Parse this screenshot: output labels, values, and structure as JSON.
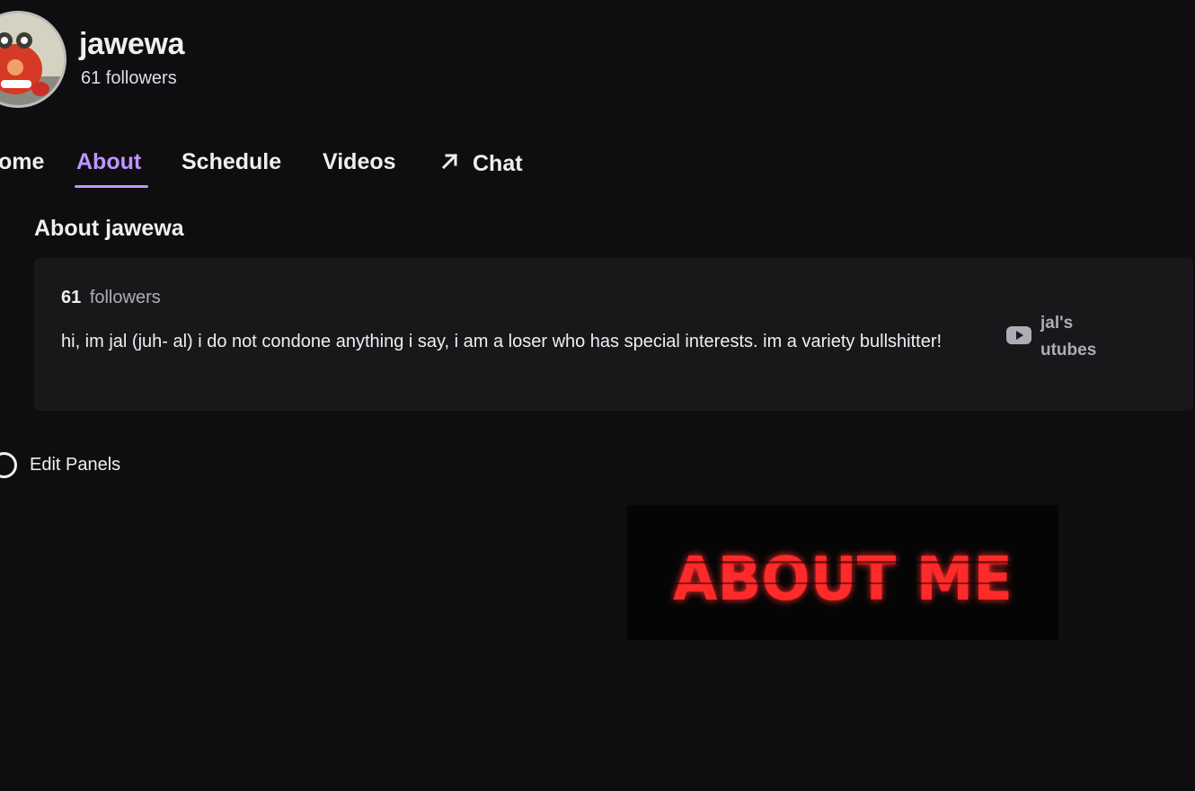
{
  "channel": {
    "name": "jawewa",
    "followers_text": "61 followers"
  },
  "tabs": [
    {
      "label": "Home",
      "visible_text": "ome"
    },
    {
      "label": "About",
      "active": true
    },
    {
      "label": "Schedule"
    },
    {
      "label": "Videos"
    },
    {
      "label": "Chat",
      "icon": "arrow-up-right-icon"
    }
  ],
  "about": {
    "heading": "About jawewa",
    "followers_count": "61",
    "followers_label": "followers",
    "bio": "hi, im jal (juh- al) i do not condone anything i say, i am a loser who has special interests. im a variety bullshitter!",
    "social_link": {
      "icon": "youtube-icon",
      "label": "jal's utubes"
    }
  },
  "edit_panels": {
    "label": "Edit Panels",
    "enabled": false
  },
  "panel": {
    "text": "ABOUT ME",
    "color": "#ff2a2a"
  },
  "colors": {
    "accent": "#bf94ff",
    "background": "#0e0e10",
    "card": "#18181b"
  }
}
